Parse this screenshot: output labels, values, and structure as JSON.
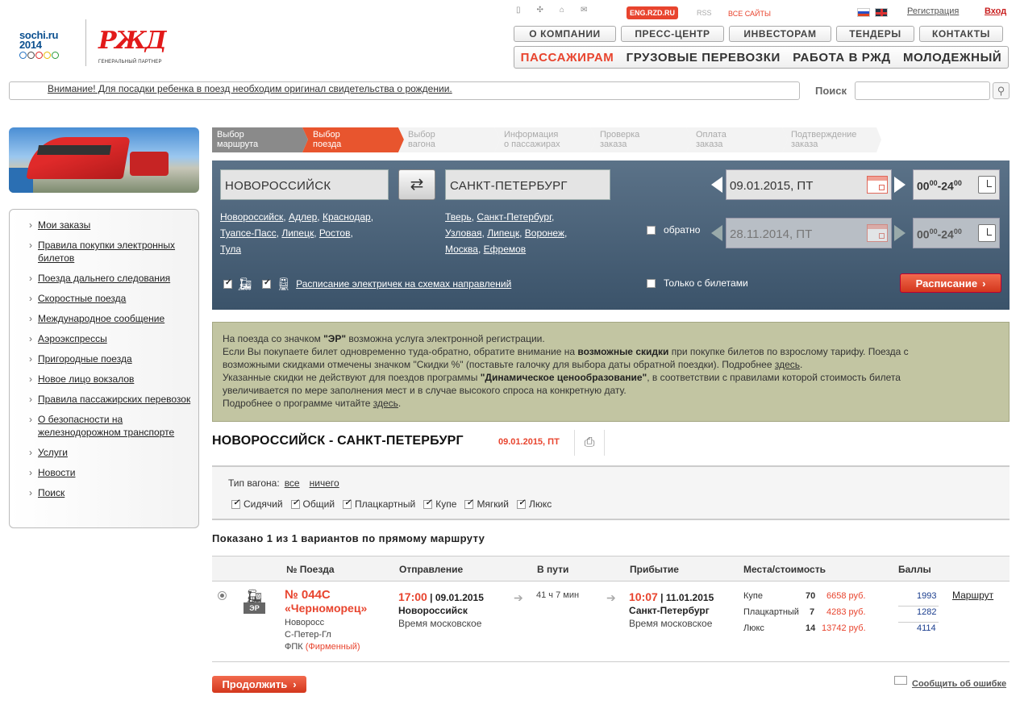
{
  "header": {
    "sochi_logo": "sochi.ru 2014",
    "rzd_logo": "РЖД",
    "partner": "ГЕНЕРАЛЬНЫЙ ПАРТНЕР",
    "eng": "ENG.RZD.RU",
    "rss": "RSS",
    "all_sites": "ВСЕ САЙТЫ",
    "register": "Регистрация",
    "login": "Вход",
    "top_nav": [
      "О КОМПАНИИ",
      "ПРЕСС-ЦЕНТР",
      "ИНВЕСТОРАМ",
      "ТЕНДЕРЫ",
      "КОНТАКТЫ"
    ],
    "main_nav": [
      "ПАССАЖИРАМ",
      "ГРУЗОВЫЕ ПЕРЕВОЗКИ",
      "РАБОТА В РЖД",
      "МОЛОДЕЖНЫЙ"
    ],
    "notice": "Внимание! Для посадки ребенка в поезд необходим оригинал свидетельства о рождении.",
    "search_label": "Поиск"
  },
  "sidebar": {
    "items": [
      "Мои заказы",
      "Правила покупки электронных билетов",
      "Поезда дальнего следования",
      "Скоростные поезда",
      "Международное сообщение",
      "Аэроэкспрессы",
      "Пригородные поезда",
      "Новое лицо вокзалов",
      "Правила пассажирских перевозок",
      "О безопасности на железнодорожном транспорте",
      "Услуги",
      "Новости",
      "Поиск"
    ]
  },
  "steps": [
    [
      "Выбор",
      "маршрута"
    ],
    [
      "Выбор",
      "поезда"
    ],
    [
      "Выбор",
      "вагона"
    ],
    [
      "Информация",
      "о пассажирах"
    ],
    [
      "Проверка",
      "заказа"
    ],
    [
      "Оплата",
      "заказа"
    ],
    [
      "Подтверждение",
      "заказа"
    ]
  ],
  "search": {
    "from": "НОВОРОССИЙСК",
    "to": "САНКТ-ПЕТЕРБУРГ",
    "from_suggest": [
      "Новороссийск",
      "Адлер",
      "Краснодар",
      "Туапсе-Пасс",
      "Липецк",
      "Ростов",
      "Тула"
    ],
    "to_suggest": [
      "Тверь",
      "Санкт-Петербург",
      "Узловая",
      "Липецк",
      "Воронеж",
      "Москва",
      "Ефремов"
    ],
    "date_there": "09.01.2015, ПТ",
    "date_back": "28.11.2014, ПТ",
    "time_from": "00",
    "time_to": "24",
    "time_min": "00",
    "return_label": "обратно",
    "only_tickets": "Только с билетами",
    "suburban_link": "Расписание электричек на схемах направлений",
    "schedule_button": "Расписание"
  },
  "info": {
    "l1a": "На поезда со значком ",
    "l1b": "\"ЭР\"",
    "l1c": " возможна услуга электронной регистрации.",
    "l2a": "Если Вы покупаете билет одновременно туда-обратно, обратите внимание на ",
    "l2b": "возможные скидки",
    "l2c": " при покупке билетов по взрослому тарифу. Поезда с",
    "l3": "возможными скидками отмечены значком \"Скидки %\" (поставьте галочку для выбора даты обратной поездки). Подробнее ",
    "here": "здесь",
    "l4a": "Указанные скидки не действуют для поездов программы ",
    "l4b": "\"Динамическое ценообразование\"",
    "l4c": ", в соответствии с правилами которой стоимость билета",
    "l5": "увеличивается по мере заполнения мест и в случае высокого спроса на конкретную дату.",
    "l6": "Подробнее о программе читайте "
  },
  "route": {
    "title": "НОВОРОССИЙСК - САНКТ-ПЕТЕРБУРГ",
    "date": "09.01.2015, ПТ"
  },
  "filter": {
    "label": "Тип вагона:",
    "all": "все",
    "none": "ничего",
    "types": [
      "Сидячий",
      "Общий",
      "Плацкартный",
      "Купе",
      "Мягкий",
      "Люкс"
    ]
  },
  "shown": "Показано 1 из 1 вариантов по прямому маршруту",
  "table": {
    "headers": [
      "№ Поезда",
      "Отправление",
      "В пути",
      "Прибытие",
      "Места/стоимость",
      "Баллы"
    ],
    "train": {
      "badge": "ЭР",
      "number": "№ 044С",
      "name": "«Черноморец»",
      "from": "Новоросс",
      "to": "С-Петер-Гл",
      "carrier": "ФПК",
      "brand": "(Фирменный)",
      "dep_time": "17:00",
      "dep_date": "| 09.01.2015",
      "dep_station": "Новороссийск",
      "dep_zone": "Время московское",
      "duration": "41 ч 7 мин",
      "arr_time": "10:07",
      "arr_date": "| 11.01.2015",
      "arr_station": "Санкт-Петербург",
      "arr_zone": "Время московское",
      "seats": [
        {
          "cls": "Купе",
          "count": "70",
          "price": "6658 руб.",
          "points": "1993"
        },
        {
          "cls": "Плацкартный",
          "count": "7",
          "price": "4283 руб.",
          "points": "1282"
        },
        {
          "cls": "Люкс",
          "count": "14",
          "price": "13742 руб.",
          "points": "4114"
        }
      ],
      "route_link": "Маршрут"
    }
  },
  "continue_button": "Продолжить",
  "report_error": "Сообщить об ошибке",
  "colors": {
    "accent": "#e8442e",
    "panel": "#4a6279",
    "info": "#c2c5a2"
  }
}
